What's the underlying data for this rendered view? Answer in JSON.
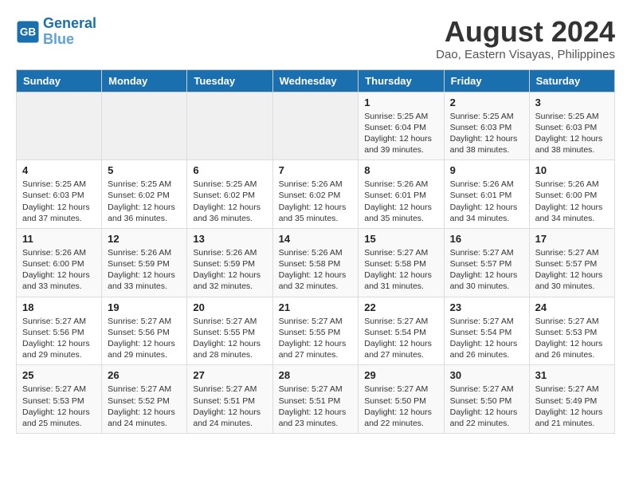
{
  "logo": {
    "line1": "General",
    "line2": "Blue"
  },
  "title": "August 2024",
  "location": "Dao, Eastern Visayas, Philippines",
  "weekdays": [
    "Sunday",
    "Monday",
    "Tuesday",
    "Wednesday",
    "Thursday",
    "Friday",
    "Saturday"
  ],
  "weeks": [
    [
      {
        "day": "",
        "sunrise": "",
        "sunset": "",
        "daylight": ""
      },
      {
        "day": "",
        "sunrise": "",
        "sunset": "",
        "daylight": ""
      },
      {
        "day": "",
        "sunrise": "",
        "sunset": "",
        "daylight": ""
      },
      {
        "day": "",
        "sunrise": "",
        "sunset": "",
        "daylight": ""
      },
      {
        "day": "1",
        "sunrise": "5:25 AM",
        "sunset": "6:04 PM",
        "daylight": "12 hours and 39 minutes."
      },
      {
        "day": "2",
        "sunrise": "5:25 AM",
        "sunset": "6:03 PM",
        "daylight": "12 hours and 38 minutes."
      },
      {
        "day": "3",
        "sunrise": "5:25 AM",
        "sunset": "6:03 PM",
        "daylight": "12 hours and 38 minutes."
      }
    ],
    [
      {
        "day": "4",
        "sunrise": "5:25 AM",
        "sunset": "6:03 PM",
        "daylight": "12 hours and 37 minutes."
      },
      {
        "day": "5",
        "sunrise": "5:25 AM",
        "sunset": "6:02 PM",
        "daylight": "12 hours and 36 minutes."
      },
      {
        "day": "6",
        "sunrise": "5:25 AM",
        "sunset": "6:02 PM",
        "daylight": "12 hours and 36 minutes."
      },
      {
        "day": "7",
        "sunrise": "5:26 AM",
        "sunset": "6:02 PM",
        "daylight": "12 hours and 35 minutes."
      },
      {
        "day": "8",
        "sunrise": "5:26 AM",
        "sunset": "6:01 PM",
        "daylight": "12 hours and 35 minutes."
      },
      {
        "day": "9",
        "sunrise": "5:26 AM",
        "sunset": "6:01 PM",
        "daylight": "12 hours and 34 minutes."
      },
      {
        "day": "10",
        "sunrise": "5:26 AM",
        "sunset": "6:00 PM",
        "daylight": "12 hours and 34 minutes."
      }
    ],
    [
      {
        "day": "11",
        "sunrise": "5:26 AM",
        "sunset": "6:00 PM",
        "daylight": "12 hours and 33 minutes."
      },
      {
        "day": "12",
        "sunrise": "5:26 AM",
        "sunset": "5:59 PM",
        "daylight": "12 hours and 33 minutes."
      },
      {
        "day": "13",
        "sunrise": "5:26 AM",
        "sunset": "5:59 PM",
        "daylight": "12 hours and 32 minutes."
      },
      {
        "day": "14",
        "sunrise": "5:26 AM",
        "sunset": "5:58 PM",
        "daylight": "12 hours and 32 minutes."
      },
      {
        "day": "15",
        "sunrise": "5:27 AM",
        "sunset": "5:58 PM",
        "daylight": "12 hours and 31 minutes."
      },
      {
        "day": "16",
        "sunrise": "5:27 AM",
        "sunset": "5:57 PM",
        "daylight": "12 hours and 30 minutes."
      },
      {
        "day": "17",
        "sunrise": "5:27 AM",
        "sunset": "5:57 PM",
        "daylight": "12 hours and 30 minutes."
      }
    ],
    [
      {
        "day": "18",
        "sunrise": "5:27 AM",
        "sunset": "5:56 PM",
        "daylight": "12 hours and 29 minutes."
      },
      {
        "day": "19",
        "sunrise": "5:27 AM",
        "sunset": "5:56 PM",
        "daylight": "12 hours and 29 minutes."
      },
      {
        "day": "20",
        "sunrise": "5:27 AM",
        "sunset": "5:55 PM",
        "daylight": "12 hours and 28 minutes."
      },
      {
        "day": "21",
        "sunrise": "5:27 AM",
        "sunset": "5:55 PM",
        "daylight": "12 hours and 27 minutes."
      },
      {
        "day": "22",
        "sunrise": "5:27 AM",
        "sunset": "5:54 PM",
        "daylight": "12 hours and 27 minutes."
      },
      {
        "day": "23",
        "sunrise": "5:27 AM",
        "sunset": "5:54 PM",
        "daylight": "12 hours and 26 minutes."
      },
      {
        "day": "24",
        "sunrise": "5:27 AM",
        "sunset": "5:53 PM",
        "daylight": "12 hours and 26 minutes."
      }
    ],
    [
      {
        "day": "25",
        "sunrise": "5:27 AM",
        "sunset": "5:53 PM",
        "daylight": "12 hours and 25 minutes."
      },
      {
        "day": "26",
        "sunrise": "5:27 AM",
        "sunset": "5:52 PM",
        "daylight": "12 hours and 24 minutes."
      },
      {
        "day": "27",
        "sunrise": "5:27 AM",
        "sunset": "5:51 PM",
        "daylight": "12 hours and 24 minutes."
      },
      {
        "day": "28",
        "sunrise": "5:27 AM",
        "sunset": "5:51 PM",
        "daylight": "12 hours and 23 minutes."
      },
      {
        "day": "29",
        "sunrise": "5:27 AM",
        "sunset": "5:50 PM",
        "daylight": "12 hours and 22 minutes."
      },
      {
        "day": "30",
        "sunrise": "5:27 AM",
        "sunset": "5:50 PM",
        "daylight": "12 hours and 22 minutes."
      },
      {
        "day": "31",
        "sunrise": "5:27 AM",
        "sunset": "5:49 PM",
        "daylight": "12 hours and 21 minutes."
      }
    ]
  ],
  "labels": {
    "sunrise": "Sunrise:",
    "sunset": "Sunset:",
    "daylight": "Daylight:"
  }
}
